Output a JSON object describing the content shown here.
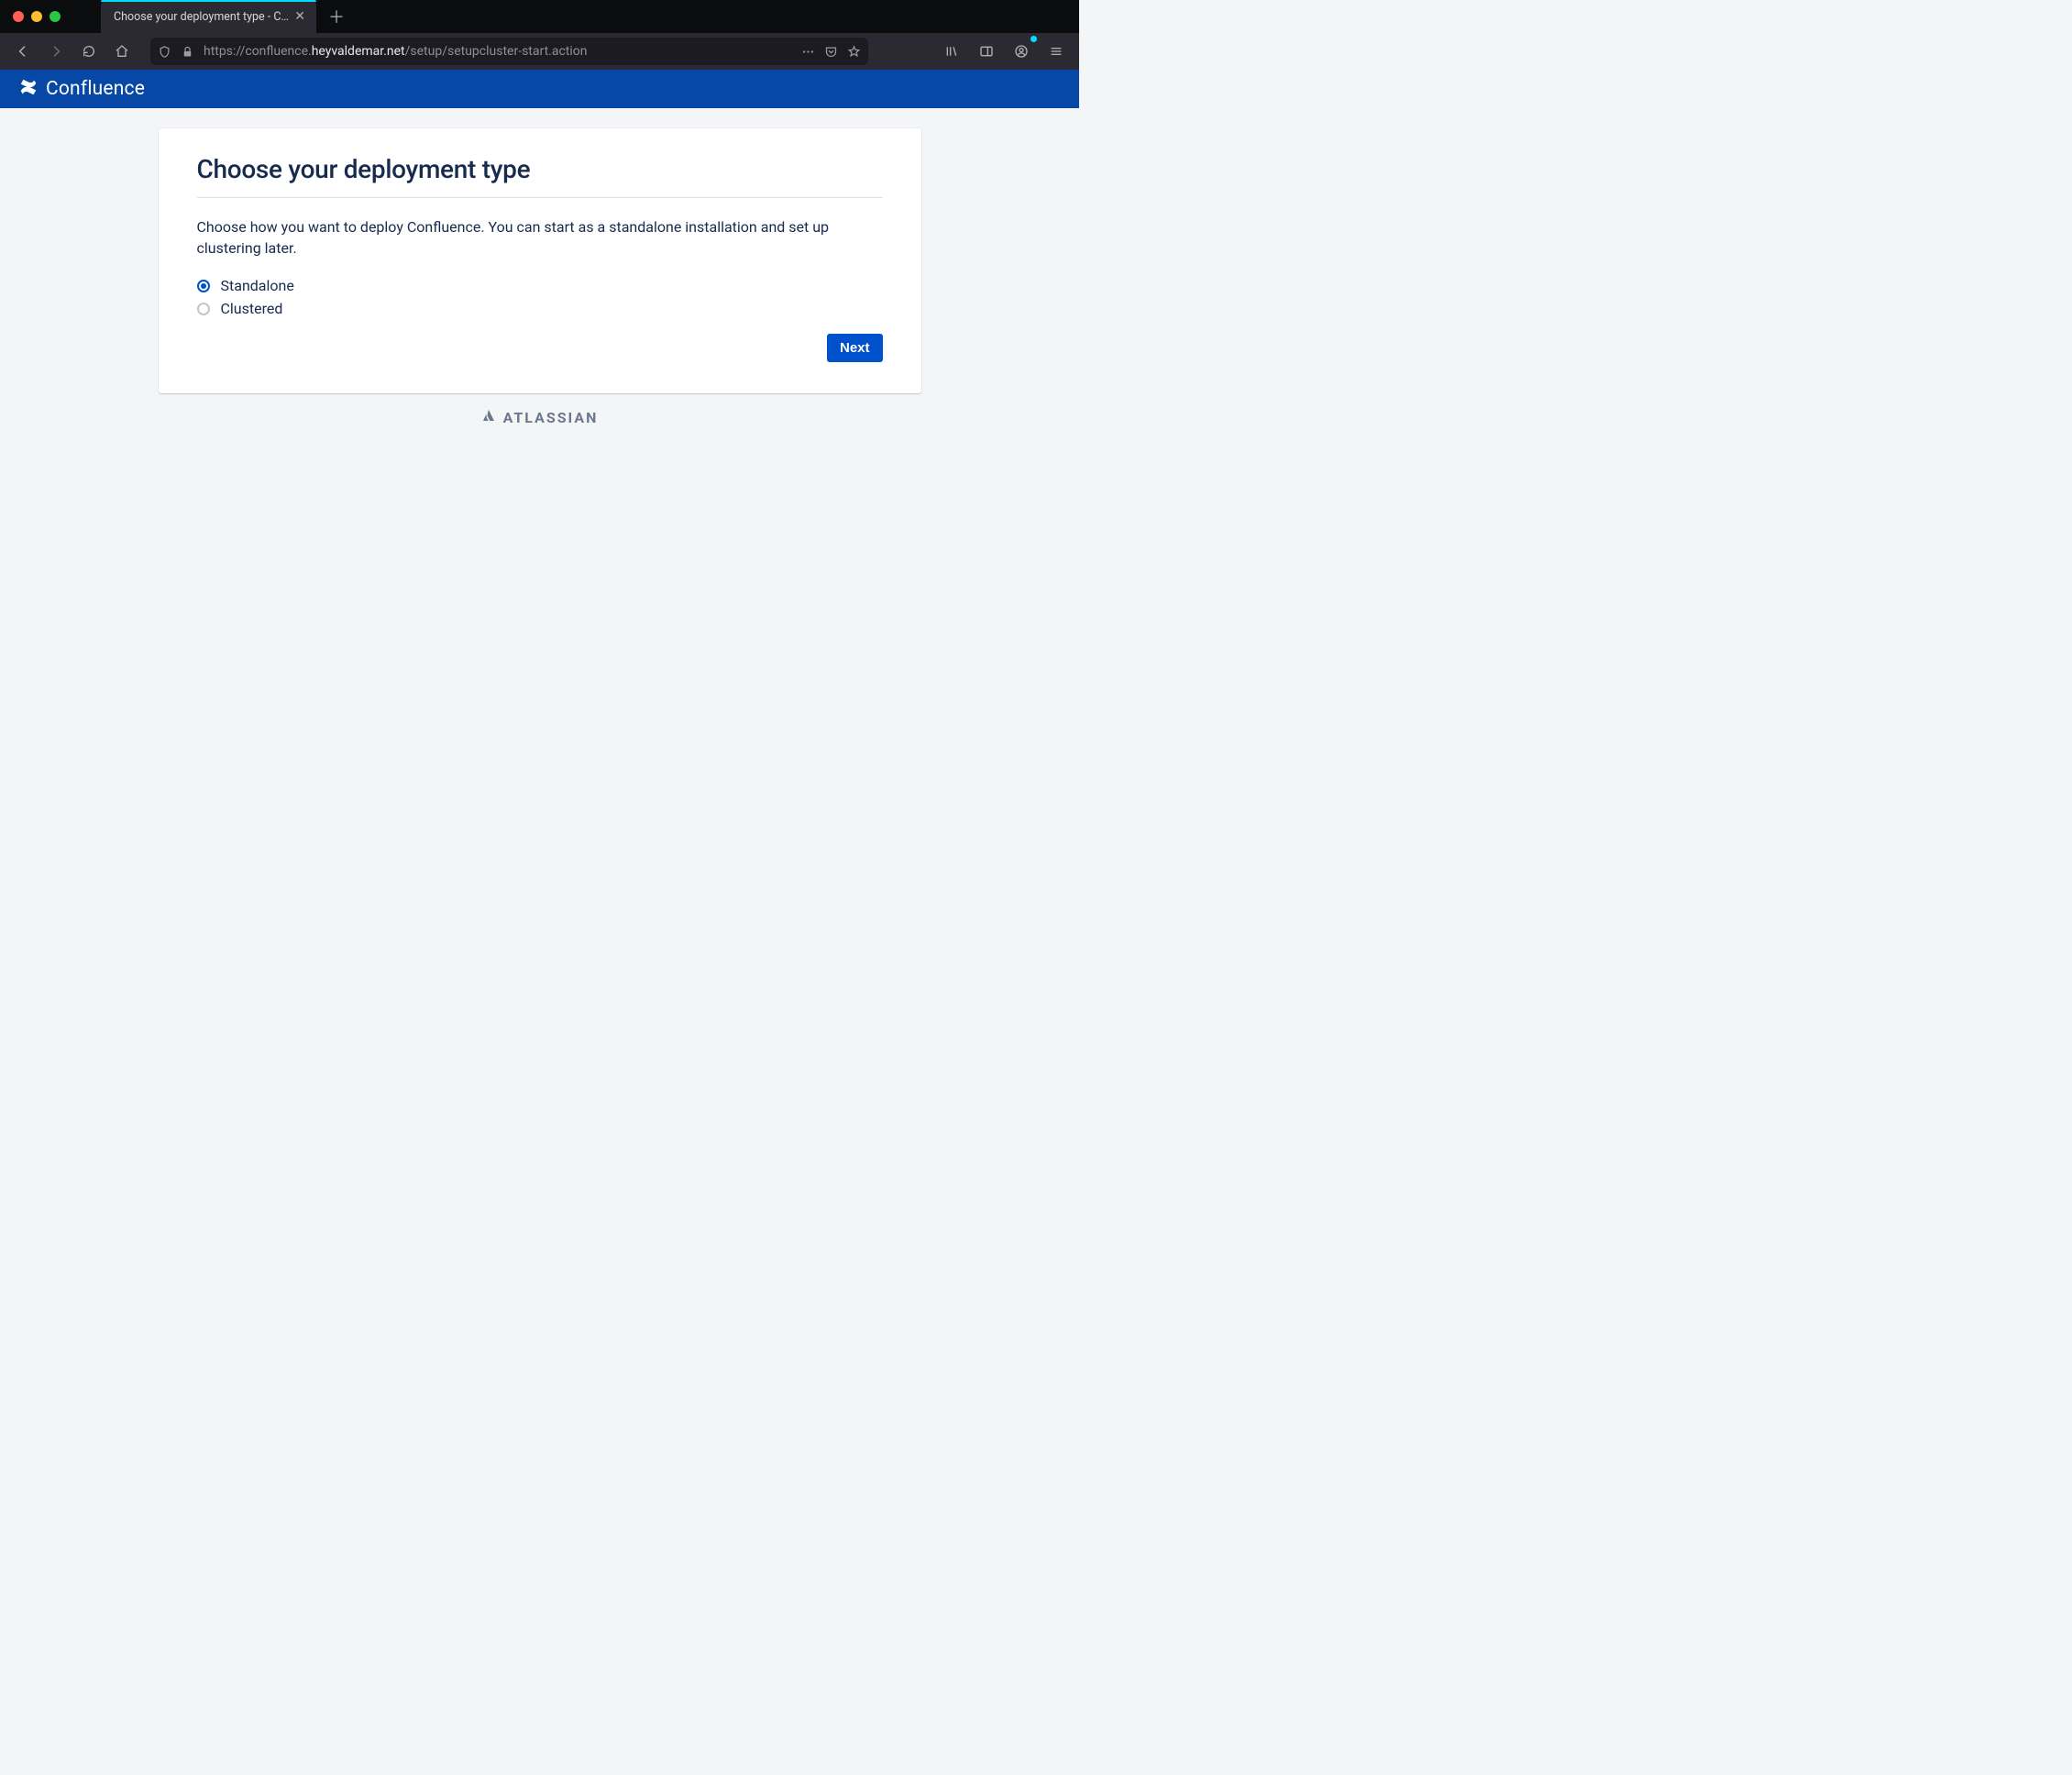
{
  "browser": {
    "tab_title": "Choose your deployment type - Con",
    "url_prefix": "https://confluence.",
    "url_domain": "heyvaldemar.net",
    "url_path": "/setup/setupcluster-start.action"
  },
  "app": {
    "product_name": "Confluence"
  },
  "page": {
    "heading": "Choose your deployment type",
    "description": "Choose how you want to deploy Confluence. You can start as a standalone installation and set up clustering later.",
    "options": {
      "standalone": "Standalone",
      "clustered": "Clustered"
    },
    "next_button": "Next"
  },
  "footer": {
    "vendor": "ATLASSIAN"
  }
}
